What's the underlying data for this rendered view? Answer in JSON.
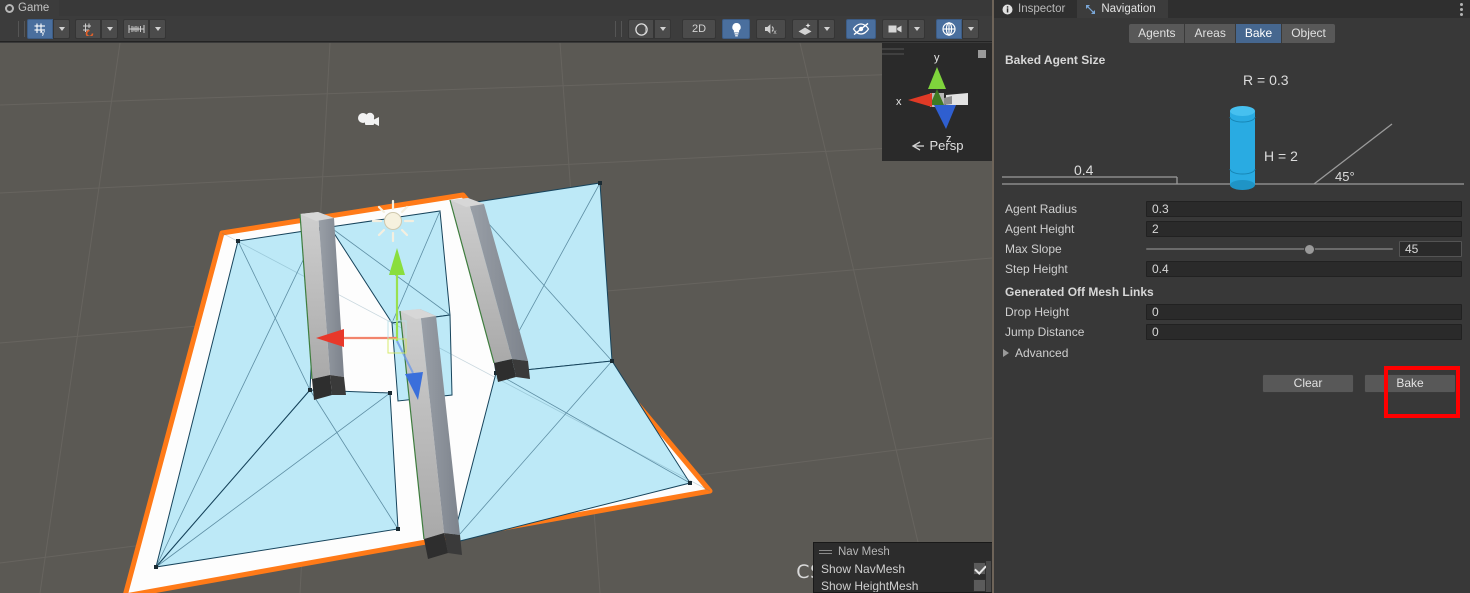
{
  "scene_panel": {
    "tab_label": "Game",
    "tab_icon": "game-view-icon",
    "toolbar": {
      "pivot_icon": "grid-axis-y-icon",
      "pivot_dropdown_icon": "chevron-down-icon",
      "snap_icon": "grid-snap-icon",
      "snap_dropdown_icon": "chevron-down-icon",
      "ruler_icon": "grid-size-ruler-icon",
      "ruler_dropdown_icon": "chevron-down-icon",
      "shading_icon": "shaded-sphere-icon",
      "shading_dropdown_icon": "chevron-down-icon",
      "twod_label": "2D",
      "lighting_icon": "lightbulb-icon",
      "audio_icon": "audio-mute-icon",
      "fx_icon": "effects-icon",
      "fx_dropdown_icon": "chevron-down-icon",
      "visibility_icon": "scene-visibility-off-icon",
      "camera_icon": "scene-camera-icon",
      "camera_dropdown_icon": "chevron-down-icon",
      "gizmos_icon": "gizmos-icon",
      "gizmos_dropdown_icon": "chevron-down-icon"
    },
    "gizmo": {
      "axis_x": "x",
      "axis_y": "y",
      "axis_z": "z",
      "projection_label": "Persp",
      "projection_icon": "lock-perspective-icon"
    },
    "navmesh_overlay": {
      "title": "Nav Mesh",
      "drag_icon": "drag-handle-icon",
      "rows": [
        {
          "label": "Show NavMesh",
          "checked": true
        },
        {
          "label": "Show HeightMesh",
          "checked": false
        }
      ]
    },
    "watermark": "CSDN @宇宙好男人",
    "colors": {
      "navmesh_fill": "#bde9f7",
      "navmesh_edge": "#17445c",
      "selection_outline": "#ff7a18",
      "wall_face": "#b9b9b9",
      "wall_side": "#8e939c",
      "background": "#5b5954",
      "axis_x": "#e03a26",
      "axis_y": "#8fe04a",
      "axis_z": "#3a6fdb"
    }
  },
  "inspector": {
    "tabs": [
      {
        "label": "Inspector",
        "icon": "info-circle-icon",
        "active": false
      },
      {
        "label": "Navigation",
        "icon": "navigation-expand-icon",
        "active": true
      }
    ],
    "menu_icon": "kebab-menu-icon",
    "segments": [
      {
        "label": "Agents",
        "active": false
      },
      {
        "label": "Areas",
        "active": false
      },
      {
        "label": "Bake",
        "active": true
      },
      {
        "label": "Object",
        "active": false
      }
    ],
    "baked_agent_size": {
      "title": "Baked Agent Size",
      "diagram": {
        "radius_label": "R = 0.3",
        "height_label": "H = 2",
        "step_label": "0.4",
        "slope_label": "45°",
        "cylinder_color": "#29abe2"
      },
      "fields": [
        {
          "label": "Agent Radius",
          "value": "0.3",
          "type": "text"
        },
        {
          "label": "Agent Height",
          "value": "2",
          "type": "text"
        },
        {
          "label": "Max Slope",
          "value": "45",
          "type": "slider",
          "slider_percent": 66
        },
        {
          "label": "Step Height",
          "value": "0.4",
          "type": "text"
        }
      ]
    },
    "generated_off_mesh_links": {
      "title": "Generated Off Mesh Links",
      "fields": [
        {
          "label": "Drop Height",
          "value": "0",
          "type": "text"
        },
        {
          "label": "Jump Distance",
          "value": "0",
          "type": "text"
        }
      ]
    },
    "advanced": {
      "label": "Advanced",
      "icon": "triangle-right-icon",
      "expanded": false
    },
    "buttons": {
      "clear_label": "Clear",
      "bake_label": "Bake",
      "bake_highlight_color": "#ff0000"
    }
  }
}
